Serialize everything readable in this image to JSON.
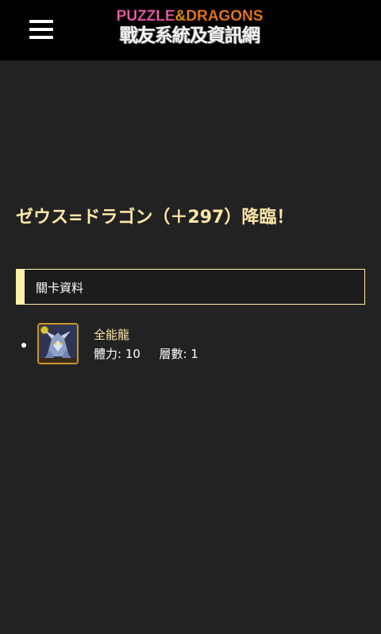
{
  "header": {
    "logo_line1_a": "PUZZLE",
    "logo_line1_amp": "&",
    "logo_line1_b": "DRAGONS",
    "logo_line2": "戰友系統及資訊網"
  },
  "page": {
    "title": "ゼウス=ドラゴン（＋297）降臨！"
  },
  "section": {
    "label": "關卡資料"
  },
  "dungeons": [
    {
      "name": "全能龍",
      "stamina_label": "體力:",
      "stamina_value": "10",
      "floors_label": "層數:",
      "floors_value": "1",
      "icon": "dragon-monster-icon"
    }
  ],
  "colors": {
    "background": "#222222",
    "topbar": "#000000",
    "accent": "#fff0a8",
    "title": "#ffe7a8",
    "icon_border": "#c9962b"
  }
}
